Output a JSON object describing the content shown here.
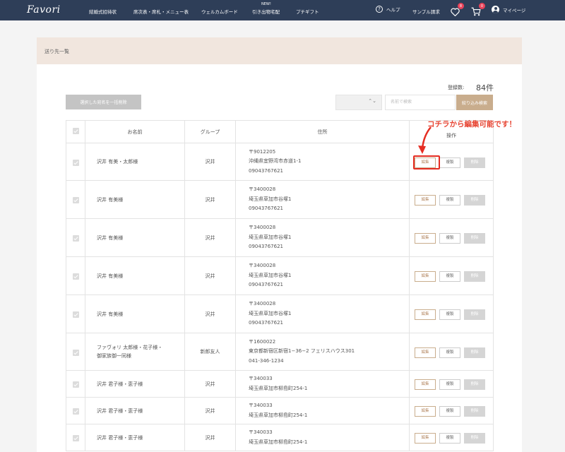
{
  "header": {
    "logo": "Favori",
    "nav": [
      "結婚式招待状",
      "席次表・席札・メニュー表",
      "ウェルカムボード",
      "引き出物宅配",
      "プチギフト"
    ],
    "nav_new": "NEW!",
    "help": "ヘルプ",
    "sample": "サンプル請求",
    "fav_badge": "8",
    "cart_badge": "0",
    "mypage": "マイページ"
  },
  "page_title": "送り先一覧",
  "count": {
    "label": "登録数:",
    "value": "84件"
  },
  "controls": {
    "bulk_delete": "選択した宛名を一括削除",
    "search_placeholder": "名前で検索",
    "filter": "絞り込み検索"
  },
  "table": {
    "headers": [
      "お名前",
      "グループ",
      "住所",
      "操作"
    ],
    "actions": {
      "edit": "編集",
      "copy": "複製",
      "delete": "削除"
    },
    "rows": [
      {
        "name": [
          "沢井 有美・太郎様"
        ],
        "group": "沢井",
        "address": [
          "〒9012205",
          "沖縄県宜野湾市赤道1-1",
          "09043767621"
        ]
      },
      {
        "name": [
          "沢井 有美様"
        ],
        "group": "沢井",
        "address": [
          "〒3400028",
          "埼玉県草加市谷塚1",
          "09043767621"
        ]
      },
      {
        "name": [
          "沢井 有美様"
        ],
        "group": "沢井",
        "address": [
          "〒3400028",
          "埼玉県草加市谷塚1",
          "09043767621"
        ]
      },
      {
        "name": [
          "沢井 有美様"
        ],
        "group": "沢井",
        "address": [
          "〒3400028",
          "埼玉県草加市谷塚1",
          "09043767621"
        ]
      },
      {
        "name": [
          "沢井 有美様"
        ],
        "group": "沢井",
        "address": [
          "〒3400028",
          "埼玉県草加市谷塚1",
          "09043767621"
        ]
      },
      {
        "name": [
          "ファヴォリ 太郎様・花子様・",
          "御家族御一同様"
        ],
        "group": "新郎友人",
        "address": [
          "〒1600022",
          "東京都新宿区新宿1−36−2 フェリスハウス301",
          "041-346-1234"
        ]
      },
      {
        "name": [
          "沢井 君子様・恵子様"
        ],
        "group": "沢井",
        "address": [
          "〒340033",
          "埼玉県草加市柳島町254-1"
        ]
      },
      {
        "name": [
          "沢井 君子様・恵子様"
        ],
        "group": "沢井",
        "address": [
          "〒340033",
          "埼玉県草加市柳島町254-1"
        ]
      },
      {
        "name": [
          "沢井 君子様・恵子様"
        ],
        "group": "沢井",
        "address": [
          "〒340033",
          "埼玉県草加市柳島町254-1"
        ]
      }
    ]
  },
  "annotation": "コチラから編集可能です！",
  "colors": {
    "header_bg": "#2e3e58",
    "accent": "#c9ad8d",
    "annotation": "#e74533",
    "badge": "#e8435a"
  }
}
